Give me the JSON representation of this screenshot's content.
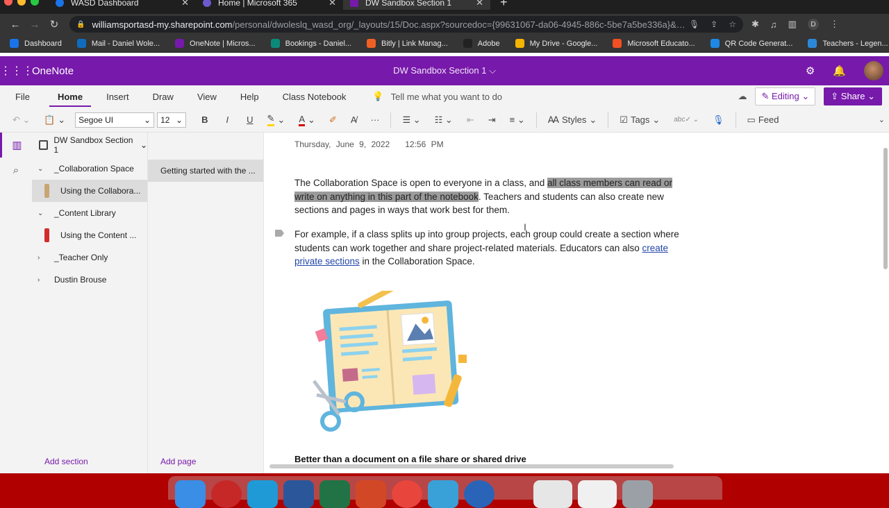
{
  "browser": {
    "tabs": [
      {
        "title": "WASD Dashboard",
        "color": "#1a73e8"
      },
      {
        "title": "Home | Microsoft 365",
        "color": "#6a5acd"
      },
      {
        "title": "DW Sandbox Section 1",
        "color": "#7719aa"
      }
    ],
    "url_host": "williamsportasd-my.sharepoint.com",
    "url_path": "/personal/dwoleslq_wasd_org/_layouts/15/Doc.aspx?sourcedoc={99631067-da06-4945-886c-5be7a5be336a}&actio...",
    "profile_initial": "D",
    "bookmarks": [
      {
        "label": "Dashboard",
        "color": "#1a73e8"
      },
      {
        "label": "Mail - Daniel Wole...",
        "color": "#0f6cbd"
      },
      {
        "label": "OneNote | Micros...",
        "color": "#7719aa"
      },
      {
        "label": "Bookings - Daniel...",
        "color": "#0b8a7a"
      },
      {
        "label": "Bitly | Link Manag...",
        "color": "#ee6123"
      },
      {
        "label": "Adobe",
        "color": "#222222"
      },
      {
        "label": "My Drive - Google...",
        "color": "#f4b400"
      },
      {
        "label": "Microsoft Educato...",
        "color": "#f25022"
      },
      {
        "label": "QR Code Generat...",
        "color": "#1e88e5"
      },
      {
        "label": "Teachers - Legen...",
        "color": "#2b88d8"
      }
    ],
    "bookmarks_more": "»"
  },
  "app": {
    "name": "OneNote",
    "doc_title": "DW Sandbox Section 1 ⌵",
    "accent": "#7719aa"
  },
  "menu": {
    "items": [
      "File",
      "Home",
      "Insert",
      "Draw",
      "View",
      "Help",
      "Class Notebook"
    ],
    "active": "Home",
    "tell_me": "Tell me what you want to do",
    "editing": "Editing",
    "share": "Share"
  },
  "ribbon": {
    "font": "Segoe UI",
    "size": "12",
    "bold": "B",
    "italic": "I",
    "underline": "U",
    "styles": "Styles",
    "tags": "Tags",
    "feed": "Feed"
  },
  "notebook": {
    "name": "DW Sandbox Section 1",
    "sections": [
      {
        "label": "_Collaboration Space",
        "caret": "⌄",
        "child": false,
        "selected": false,
        "color": ""
      },
      {
        "label": "Using the Collabora...",
        "caret": "",
        "child": true,
        "selected": true,
        "color": "#c9a574"
      },
      {
        "label": "_Content Library",
        "caret": "⌄",
        "child": false,
        "selected": false,
        "color": ""
      },
      {
        "label": "Using the Content ...",
        "caret": "",
        "child": true,
        "selected": false,
        "color": "#d42b2b"
      },
      {
        "label": "_Teacher Only",
        "caret": "›",
        "child": false,
        "selected": false,
        "color": ""
      },
      {
        "label": "Dustin Brouse",
        "caret": "›",
        "child": false,
        "selected": false,
        "color": ""
      }
    ],
    "add_section": "Add section",
    "pages": [
      "Getting started with the ..."
    ],
    "add_page": "Add page"
  },
  "page": {
    "date": "Thursday, June 9, 2022",
    "time": "12:56 PM",
    "p1_a": "The Collaboration Space is open to everyone in a class, and ",
    "p1_hl": "all class members can read or write on anything in this part of the notebook",
    "p1_b": ". Teachers and students can also create new sections and pages in ways that work best for them.",
    "p2_a": "For example, if a class splits up into group projects, each group could create a section where students can work together and share project-related materials. Educators can also ",
    "p2_link": "create private sections",
    "p2_b": " in the Collaboration Space.",
    "bottom_heading": "Better than a document on a file share or shared drive"
  }
}
